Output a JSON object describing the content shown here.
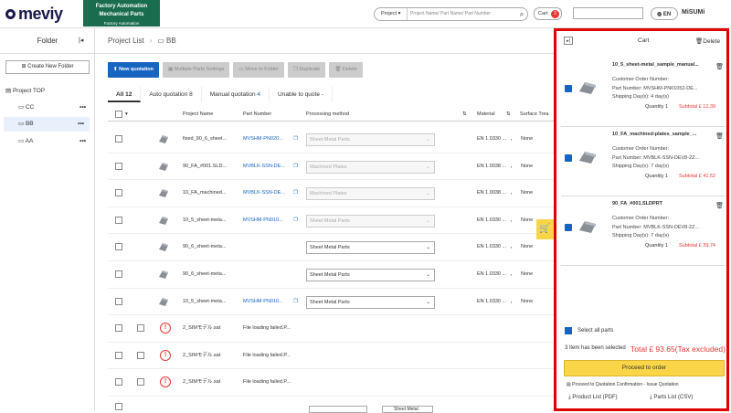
{
  "header": {
    "logo": "meviy",
    "banner_line1": "Factory Automation",
    "banner_line2": "Mechanical Parts",
    "banner_line3": "Factory Automation",
    "search_category": "Project",
    "search_placeholder": "Project Name/ Part Name/ Part Number",
    "cart_label": "Cart",
    "cart_count": "3",
    "language": "EN",
    "brand": "MiSUMi"
  },
  "sidebar": {
    "title": "Folder",
    "new_folder_label": "Create New Folder",
    "items": [
      {
        "label": "Project TOP",
        "level": 0
      },
      {
        "label": "CC",
        "level": 1
      },
      {
        "label": "BB",
        "level": 1
      },
      {
        "label": "AA",
        "level": 1
      }
    ]
  },
  "main": {
    "breadcrumb_root": "Project List",
    "breadcrumb_current": "BB",
    "actions": {
      "new_quotation": "New quotation",
      "multiple_settings": "Multiple Parts Settings",
      "move_folder": "Move to Folder",
      "duplicate": "Duplicate",
      "delete": "Delete"
    },
    "tabs": [
      {
        "label": "All",
        "count": "12"
      },
      {
        "label": "Auto quotation",
        "count": "8"
      },
      {
        "label": "Manual quotation",
        "count": "4"
      },
      {
        "label": "Unable to quote -",
        "count": ""
      }
    ],
    "columns": {
      "project_name": "Project Name",
      "part_number": "Part Number",
      "processing_method": "Processing method",
      "material": "Material",
      "surface": "Surface Trea"
    },
    "rows": [
      {
        "name": "fixed_90_6_sheet...",
        "pn": "MVSHM-PN020...",
        "proc": "Sheet Metal Parts",
        "proc_enabled": false,
        "material": "EN 1.0330 ...",
        "surface": "None",
        "error": false
      },
      {
        "name": "90_FA_#001.SLD...",
        "pn": "MVBLK-SSN-DE...",
        "proc": "Machined Plates",
        "proc_enabled": false,
        "material": "EN 1.0038 ...",
        "surface": "None",
        "error": false
      },
      {
        "name": "10_FA_machined...",
        "pn": "MVBLK-SSN-DE...",
        "proc": "Machined Plates",
        "proc_enabled": false,
        "material": "EN 1.0038 ...",
        "surface": "None",
        "error": false
      },
      {
        "name": "10_5_sheet-meta...",
        "pn": "MVSHM-PN010...",
        "proc": "Sheet Metal Parts",
        "proc_enabled": false,
        "material": "EN 1.0330 ...",
        "surface": "None",
        "error": false
      },
      {
        "name": "90_6_sheet-meta...",
        "pn": "",
        "proc": "Sheet Metal Parts",
        "proc_enabled": true,
        "material": "EN 1.0330 ...",
        "surface": "None",
        "error": false
      },
      {
        "name": "90_6_sheet-meta...",
        "pn": "",
        "proc": "Sheet Metal Parts",
        "proc_enabled": true,
        "material": "EN 1.0330 ...",
        "surface": "None",
        "error": false
      },
      {
        "name": "10_5_sheet-meta...",
        "pn": "MVSHM-PN010...",
        "proc": "Sheet Metal Parts",
        "proc_enabled": true,
        "material": "EN 1.0330 ...",
        "surface": "None",
        "error": false
      },
      {
        "name": "2_SIMモデル.sat",
        "pn": "File loading failed.P...",
        "proc": "",
        "proc_enabled": false,
        "material": "",
        "surface": "",
        "error": true
      },
      {
        "name": "2_SIMモデル.sat",
        "pn": "File loading failed.P...",
        "proc": "",
        "proc_enabled": false,
        "material": "",
        "surface": "",
        "error": true
      },
      {
        "name": "2_SIMモデル.sat",
        "pn": "File loading failed.P...",
        "proc": "",
        "proc_enabled": false,
        "material": "",
        "surface": "",
        "error": true
      }
    ],
    "last_row_proc": "Sheet Metal"
  },
  "cart": {
    "title": "Cart",
    "delete_label": "Delete",
    "items": [
      {
        "title": "10_5_sheet-metal_sample_manual...",
        "order_label": "Customer Order Number:",
        "part_number": "Part Number: MVSHM-PN01052-DE...",
        "shipping": "Shipping Day(s): 4 day(s)",
        "quantity": "Quantity 1",
        "subtotal": "Subtotal  £ 12.39"
      },
      {
        "title": "10_FA_machined-plates_sample_...",
        "order_label": "Customer Order Number:",
        "part_number": "Part Number: MVBLK-SSN-DEV8-2Z...",
        "shipping": "Shipping Day(s): 7 day(s)",
        "quantity": "Quantity 1",
        "subtotal": "Subtotal  £ 41.52"
      },
      {
        "title": "90_FA_#001.SLDPRT",
        "order_label": "Customer Order Number:",
        "part_number": "Part Number: MVBLK-SSN-DEV8-2Z...",
        "shipping": "Shipping Day(s): 7 day(s)",
        "quantity": "Quantity 1",
        "subtotal": "Subtotal  £ 39.74"
      }
    ],
    "select_all": "Select all parts",
    "count_line": "3 item has been selected",
    "total": "Total £ 93.65(Tax excluded)",
    "proceed": "Proceed to order",
    "confirm": "Proceed to Quotation Confirmation - Issue Quotation",
    "pdf": "Product List (PDF)",
    "csv": "Parts List (CSV)"
  }
}
